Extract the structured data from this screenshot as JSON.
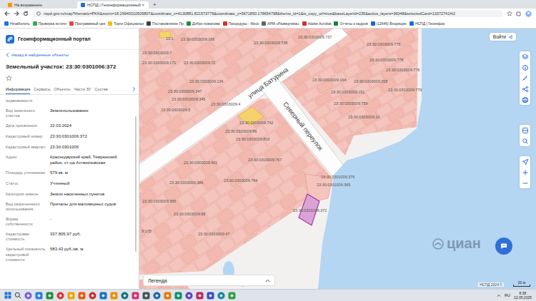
{
  "browser": {
    "tabs": [
      {
        "label": "На возражение",
        "selected": false
      },
      {
        "label": "НСПД | Геоинформационный",
        "selected": true
      }
    ],
    "tab_close": "×",
    "new_tab": "+",
    "url": "nspd.gov.ru/map?thematic=PKK&zoom=18.29940010505807&coordinate_x=4130881.821573779&coordinate_y=5671850.178654798&theme_id=1&is_copy_url=true&baseLayerId=235&active_layers=36048&selectedCard=13372741%2",
    "bookmarks": [
      "Незабилить",
      "Проверка источн",
      "Программный цен",
      "Торги Официальн",
      "Постановление Пр",
      "Добро пожалова",
      "Процедуры - Моск",
      "АРМ «Разведчика»",
      "Adobe Acrobat",
      "Отчеты о кадров",
      "(12646) Входящие",
      "НСПД | Геоинфор"
    ]
  },
  "app": {
    "title": "Геоинформационный портал",
    "login": "Войти"
  },
  "panel": {
    "back": "Назад в найденные объекты",
    "title": "Земельный участок: 23:30:0301006:372",
    "tabs": [
      {
        "label": "Информация",
        "selected": true
      },
      {
        "label": "Сервисы",
        "selected": false
      },
      {
        "label": "Объекты",
        "selected": false
      },
      {
        "label": "Части ЗУ",
        "selected": false
      },
      {
        "label": "Состав",
        "selected": false
      }
    ],
    "rows": [
      {
        "label": "недвижимости"
      },
      {
        "label": "Вид земельного участка",
        "value": "Землепользование"
      },
      {
        "label": "Дата присвоения",
        "value": "22.03.2024"
      },
      {
        "label": "Кадастровый номер",
        "value": "23:30:0301006:372"
      },
      {
        "label": "Кадастровый квартал",
        "value": "23:30:0301006"
      },
      {
        "label": "Адрес",
        "value": "Краснодарский край, Темрюкский район, ст-ца Ахтанизовская"
      },
      {
        "label": "Площадь уточненная",
        "value": "579 кв. м"
      },
      {
        "label": "Статус",
        "value": "Учтенный"
      },
      {
        "label": "Категория земель",
        "value": "Земли населенных пунктов"
      },
      {
        "label": "Вид разрешенного использования",
        "value": "Причалы для маломерных судов"
      },
      {
        "label": "Форма собственности",
        "value": "-"
      },
      {
        "label": "Кадастровая стоимость",
        "value": "337 805,97 руб."
      },
      {
        "label": "Удельный показатель кадастровой стоимости",
        "value": "583,43 руб./кв. м"
      }
    ]
  },
  "map": {
    "streets": [
      "улица Батурина",
      "Северный переулок"
    ],
    "labels": [
      "13:1",
      "23:30:0303009:166",
      "23:30:0303009:7",
      "23:30:0303009:171",
      "23:30:0303009:72",
      "23:30:0303009:134",
      "23:30:0303009:347",
      "23:30:0303009:346",
      "23:30:0303009:5",
      "23:30:0303009:738",
      "23:30:0303009:737",
      "23:30:0303009:4",
      "23:30:0303009:742",
      "23:30:0303009:86",
      "23:30:0303009:803",
      "23:30:0303009:401",
      "23:30:0303009:767",
      "23:30:0303009:764",
      "23:30:0303009:386",
      "23:30:0303009:395",
      "23:30:0303009:68",
      "9:105",
      "23:30:0303009:47",
      "23:30:0303009:775",
      "23:30:0303009:778",
      "23:30:0303009:776",
      "23:30:0303009:779",
      "23:30:0303009:164",
      "23:30:0303009:358",
      "23:30:0303009:151",
      "23:30:0303009:759",
      "23:30:0303009:10",
      "23:30:0301006:376",
      "23:30:0301006:365"
    ],
    "selected_parcel": {
      "label": "23:30:0301006:372",
      "selected": true
    },
    "legend": "Легенда",
    "watermark": "циан",
    "attribution": "НСПД 2024 ©",
    "scale": "20 м"
  },
  "taskbar": {
    "lang": "RU",
    "time": "8:38",
    "date": "12.05.2025"
  }
}
